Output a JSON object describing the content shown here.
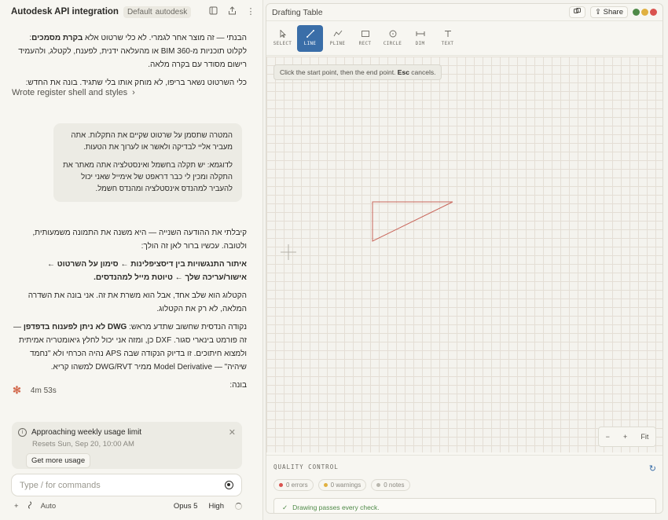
{
  "chat": {
    "title": "Autodesk API integration",
    "project_tag": [
      "Default",
      "autodesk"
    ],
    "header_icons": [
      "sidebar-icon",
      "share-icon",
      "more-icon"
    ],
    "assistant_intro": {
      "line1_pre": "הבנתי — זה מוצר אחר לגמרי. לא כלי שרטוט אלא ",
      "line1_bold": "בקרת מסמכים",
      "line1_post": ": לקלוט תוכניות מ-BIM 360 או מהעלאה ידנית, לפענח, לקטלג, ולהעמיד רישום מסודר עם בקרה מלאה.",
      "line2": "כלי השרטוט נשאר בריפו, לא מוחק אותו בלי שתגיד. בונה את החדש:"
    },
    "wrote_label": "Wrote register shell and styles",
    "user_message": {
      "p1": "המטרה שתסמן על שרטוט שקיים את התקלות. אתה מעביר אליי לבדיקה ולאשר או לערוך את הטעות.",
      "p2": "לדוגמא: יש תקלה בחשמל ואינסטלציה אתה מאתר את התקלה ומכין לי כבר דראפט של אימייל שאני יכול להעביר למהנדס אינסטלציה ומהנדס חשמל."
    },
    "assistant_reply": {
      "p1": "קיבלתי את ההודעה השנייה — היא משנה את התמונה משמעותית, ולטובה. עכשיו ברור לאן זה הולך:",
      "p2_bold": "איתור התנגשויות בין דיסציפלינות ← סימון על השרטוט ← אישור/עריכה שלך ← טיוטת מייל למהנדסים.",
      "p3": "הקטלוג הוא שלב אחד, אבל הוא משרת את זה. אני בונה את השדרה המלאה, לא רק את הקטלוג.",
      "p4_pre": "נקודה הנדסית שחשוב שתדע מראש: ",
      "p4_bold": "DWG לא ניתן לפענוח בדפדפן",
      "p4_post": " — זה פורמט בינארי סגור. DXF כן, ומזה אני יכול לחלץ גיאומטריה אמיתית ולמצוא חיתוכים. זו בדיוק הנקודה שבה APS נהיה הכרחי ולא \"נחמד שיהיה\" — Model Derivative ממיר DWG/RVT למשהו קריא.",
      "p5": "בונה:"
    },
    "elapsed": "4m 53s",
    "usage_card": {
      "title": "Approaching weekly usage limit",
      "subtitle": "Resets Sun, Sep 20, 10:00 AM",
      "button": "Get more usage"
    },
    "composer_placeholder": "Type / for commands",
    "footer": {
      "mode": "Auto",
      "model": "Opus 5",
      "effort": "High"
    }
  },
  "drafting": {
    "title": "Drafting Table",
    "share_label": "Share",
    "window_dots": [
      "#4f8a48",
      "#e0b040",
      "#d9534f"
    ],
    "tools": [
      {
        "label": "SELECT",
        "icon": "cursor-icon"
      },
      {
        "label": "LINE",
        "icon": "line-icon",
        "active": true
      },
      {
        "label": "PLINE",
        "icon": "polyline-icon"
      },
      {
        "label": "RECT",
        "icon": "rect-icon"
      },
      {
        "label": "CIRCLE",
        "icon": "circle-icon"
      },
      {
        "label": "DIM",
        "icon": "dimension-icon"
      },
      {
        "label": "TEXT",
        "icon": "text-icon"
      }
    ],
    "hint_pre": "Click the start point, then the end point. ",
    "hint_key": "Esc",
    "hint_post": " cancels.",
    "zoom": {
      "minus": "−",
      "plus": "+",
      "fit": "Fit"
    },
    "qc": {
      "heading": "QUALITY CONTROL",
      "errors": "0 errors",
      "warnings": "0 warnings",
      "notes": "0 notes",
      "status": "Drawing passes every check."
    },
    "colors": {
      "accent": "#3a6ea8",
      "shape_stroke": "#c9675c",
      "error": "#d9534f",
      "warning": "#e0b040",
      "note": "#b9b7ae",
      "pass": "#4f8a48"
    }
  }
}
